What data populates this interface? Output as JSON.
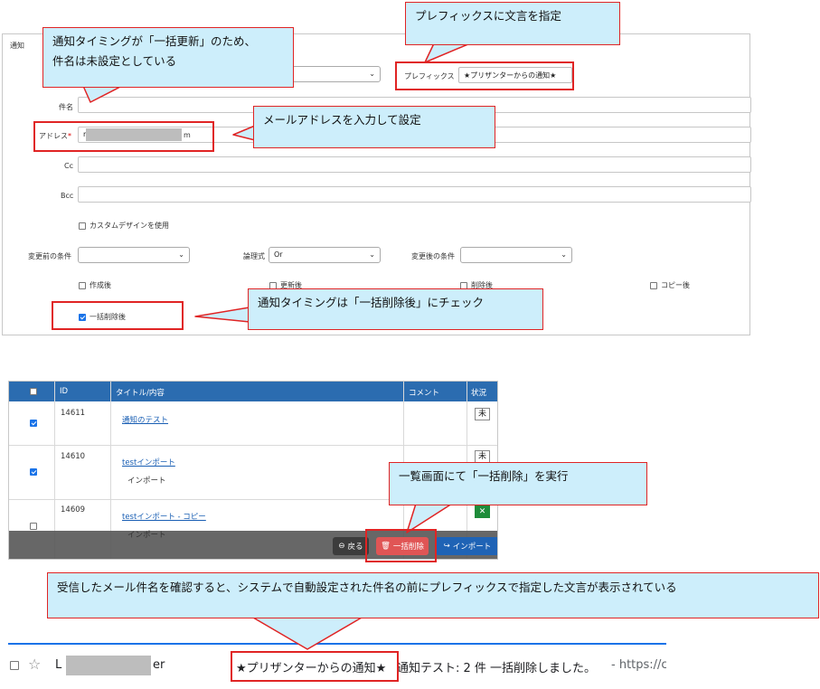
{
  "form": {
    "section_label": "通知",
    "prefix": {
      "label": "プレフィックス",
      "value": "★プリザンターからの通知★"
    },
    "subject": {
      "label": "件名",
      "value": ""
    },
    "address": {
      "label": "アドレス",
      "required_mark": "*",
      "value_start": "m",
      "value_end": "m"
    },
    "cc": {
      "label": "Cc"
    },
    "bcc": {
      "label": "Bcc"
    },
    "custom_design": {
      "label": "カスタムデザインを使用",
      "checked": false
    },
    "before_condition": {
      "label": "変更前の条件",
      "value": ""
    },
    "logic": {
      "label": "論理式",
      "value": "Or"
    },
    "after_condition": {
      "label": "変更後の条件",
      "value": ""
    },
    "timings": [
      {
        "label": "作成後",
        "checked": false
      },
      {
        "label": "更新後",
        "checked": false
      },
      {
        "label": "削除後",
        "checked": false
      },
      {
        "label": "コピー後",
        "checked": false
      }
    ],
    "bulk_delete": {
      "label": "一括削除後",
      "checked": true
    }
  },
  "callouts": {
    "prefix": "プレフィックスに文言を指定",
    "subject_line1": "通知タイミングが「一括更新」のため、",
    "subject_line2": "件名は未設定としている",
    "address": "メールアドレスを入力して設定",
    "timing": "通知タイミングは「一括削除後」にチェック",
    "bulk_delete": "一覧画面にて「一括削除」を実行",
    "mail": "受信したメール件名を確認すると、システムで自動設定された件名の前にプレフィックスで指定した文言が表示されている"
  },
  "list": {
    "columns": {
      "id": "ID",
      "title": "タイトル/内容",
      "comment": "コメント",
      "status": "状況"
    },
    "rows": [
      {
        "id": "14611",
        "title": "通知のテスト",
        "body": "",
        "checked": true,
        "status": "未"
      },
      {
        "id": "14610",
        "title": "testインポート",
        "body": "インポート",
        "checked": true,
        "status": "未"
      },
      {
        "id": "14609",
        "title": "testインポート - コピー",
        "body": "インポート",
        "checked": false,
        "status": ""
      }
    ],
    "buttons": {
      "back": "戻る",
      "bulk_delete": "一括削除",
      "import": "インポート"
    }
  },
  "mail": {
    "sender_start": "L",
    "sender_end": "er",
    "subject_prefix": "★プリザンターからの通知★",
    "subject_rest": "通知テスト: 2 件 一括削除しました。",
    "snippet": "- https://c"
  },
  "colors": {
    "callout_bg": "#cdeefb",
    "callout_border": "#e02424",
    "header_blue": "#2b6cb0",
    "delete_red": "#e05555",
    "import_blue": "#1f63b5"
  }
}
